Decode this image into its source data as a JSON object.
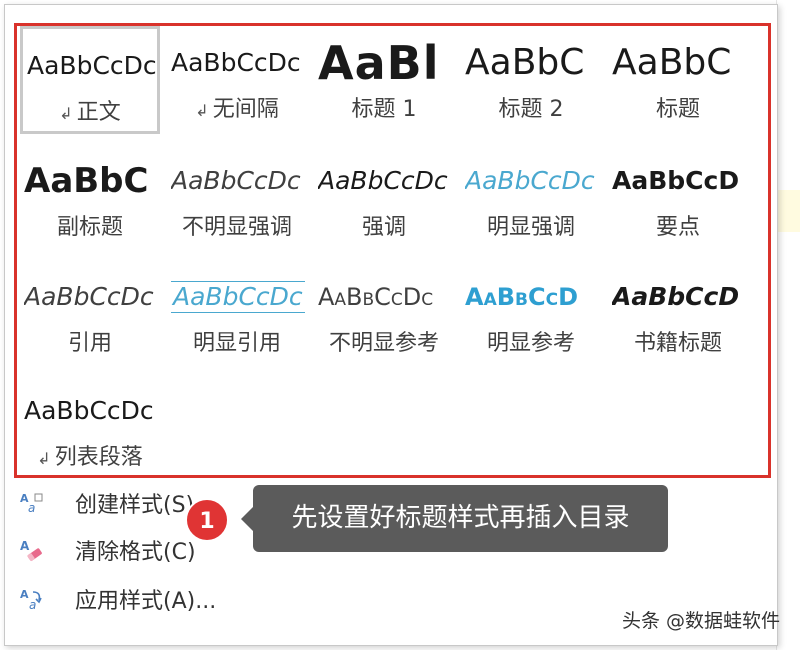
{
  "gallery": {
    "styles": [
      {
        "sample": "AaBbCcDc",
        "label": "正文",
        "mark": "↲"
      },
      {
        "sample": "AaBbCcDc",
        "label": "无间隔",
        "mark": "↲"
      },
      {
        "sample": "AaBl",
        "label": "标题 1"
      },
      {
        "sample": "AaBbC",
        "label": "标题 2"
      },
      {
        "sample": "AaBbC",
        "label": "标题"
      },
      {
        "sample": "AaBbC",
        "label": "副标题"
      },
      {
        "sample": "AaBbCcDc",
        "label": "不明显强调"
      },
      {
        "sample": "AaBbCcDc",
        "label": "强调"
      },
      {
        "sample": "AaBbCcDc",
        "label": "明显强调"
      },
      {
        "sample": "AaBbCcD",
        "label": "要点"
      },
      {
        "sample": "AaBbCcDc",
        "label": "引用"
      },
      {
        "sample": "AaBbCcDc",
        "label": "明显引用"
      },
      {
        "sample": "AaBbCcDc",
        "label": "不明显参考"
      },
      {
        "sample": "AaBbCcD",
        "label": "明显参考"
      },
      {
        "sample": "AaBbCcD",
        "label": "书籍标题"
      },
      {
        "sample": "AaBbCcDc",
        "label": "列表段落",
        "mark": "↲"
      }
    ]
  },
  "menu": {
    "create": "创建样式(S)",
    "clear": "清除格式(C)",
    "apply": "应用样式(A)..."
  },
  "callout": {
    "badge": "1",
    "text": "先设置好标题样式再插入目录"
  },
  "watermark": "头条 @数据蛙软件",
  "colors": {
    "highlight_border": "#d9322b",
    "accent_blue": "#4aa8cf",
    "callout_bg": "#5b5b5b",
    "badge": "#e03434"
  }
}
